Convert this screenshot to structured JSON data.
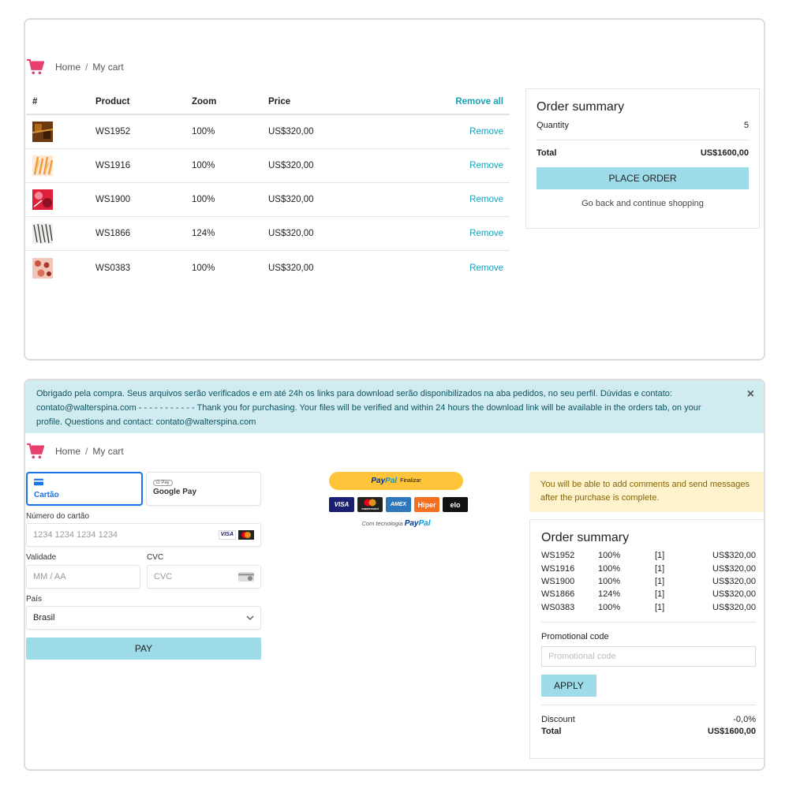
{
  "breadcrumb": {
    "home": "Home",
    "sep": "/",
    "current": "My cart"
  },
  "cart_table": {
    "headers": {
      "hash": "#",
      "product": "Product",
      "zoom": "Zoom",
      "price": "Price",
      "remove_all": "Remove all"
    },
    "rows": [
      {
        "product": "WS1952",
        "zoom": "100%",
        "price": "US$320,00",
        "action": "Remove"
      },
      {
        "product": "WS1916",
        "zoom": "100%",
        "price": "US$320,00",
        "action": "Remove"
      },
      {
        "product": "WS1900",
        "zoom": "100%",
        "price": "US$320,00",
        "action": "Remove"
      },
      {
        "product": "WS1866",
        "zoom": "124%",
        "price": "US$320,00",
        "action": "Remove"
      },
      {
        "product": "WS0383",
        "zoom": "100%",
        "price": "US$320,00",
        "action": "Remove"
      }
    ]
  },
  "summary_top": {
    "title": "Order summary",
    "quantity_label": "Quantity",
    "quantity_value": "5",
    "total_label": "Total",
    "total_value": "US$1600,00",
    "place_order": "PLACE ORDER",
    "go_back": "Go back and continue shopping"
  },
  "alert_info": {
    "text": "Obrigado pela compra. Seus arquivos serão verificados e em até 24h os links para download serão disponibilizados na aba pedidos, no seu perfil. Dúvidas e contato: contato@walterspina.com - - - - - - - - - - - Thank you for purchasing. Your files will be verified and within 24 hours the download link will be available in the orders tab, on your profile. Questions and contact: contato@walterspina.com",
    "close": "×"
  },
  "payment": {
    "tab_card": "Cartão",
    "tab_gpay_badge": "G Pay",
    "tab_gpay": "Google Pay",
    "card_number_label": "Número do cartão",
    "card_number_placeholder": "1234 1234 1234 1234",
    "expiry_label": "Validade",
    "expiry_placeholder": "MM / AA",
    "cvc_label": "CVC",
    "cvc_placeholder": "CVC",
    "country_label": "País",
    "country_value": "Brasil",
    "pay_button": "PAY"
  },
  "paypal": {
    "btn_pay": "Pay",
    "btn_pal": "Pal",
    "btn_finalizar": "Finalizar",
    "cards": [
      "VISA",
      "mastercard",
      "AMEX",
      "Hiper",
      "elo"
    ],
    "tech_text": "Com tecnologia",
    "tech_pay": "Pay",
    "tech_pal": "Pal"
  },
  "alert_warn": {
    "text": "You will be able to add comments and send messages after the purchase is complete."
  },
  "summary_bottom": {
    "title": "Order summary",
    "items": [
      {
        "code": "WS1952",
        "zoom": "100%",
        "qty": "[1]",
        "price": "US$320,00"
      },
      {
        "code": "WS1916",
        "zoom": "100%",
        "qty": "[1]",
        "price": "US$320,00"
      },
      {
        "code": "WS1900",
        "zoom": "100%",
        "qty": "[1]",
        "price": "US$320,00"
      },
      {
        "code": "WS1866",
        "zoom": "124%",
        "qty": "[1]",
        "price": "US$320,00"
      },
      {
        "code": "WS0383",
        "zoom": "100%",
        "qty": "[1]",
        "price": "US$320,00"
      }
    ],
    "promo_label": "Promotional code",
    "promo_placeholder": "Promotional code",
    "apply": "APPLY",
    "discount_label": "Discount",
    "discount_value": "-0,0%",
    "total_label": "Total",
    "total_value": "US$1600,00"
  },
  "colors": {
    "accent": "#17a2b8",
    "button_bg": "#9ddbe8",
    "cart_icon": "#e83e6c",
    "info_bg": "#d1ecf1",
    "warn_bg": "#fff3cd"
  }
}
